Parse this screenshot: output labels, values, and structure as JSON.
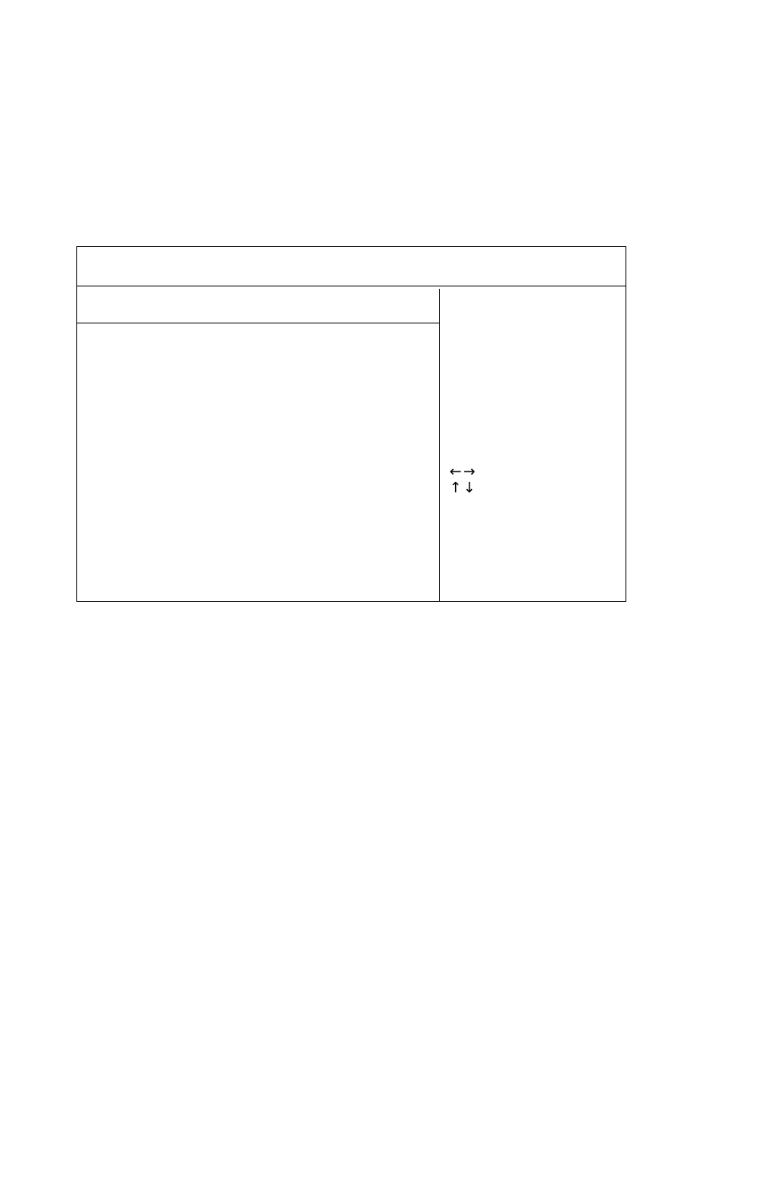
{
  "icons": {
    "left_arrow": "←",
    "right_arrow": "→",
    "up_arrow": "↑",
    "down_arrow": "↓"
  }
}
